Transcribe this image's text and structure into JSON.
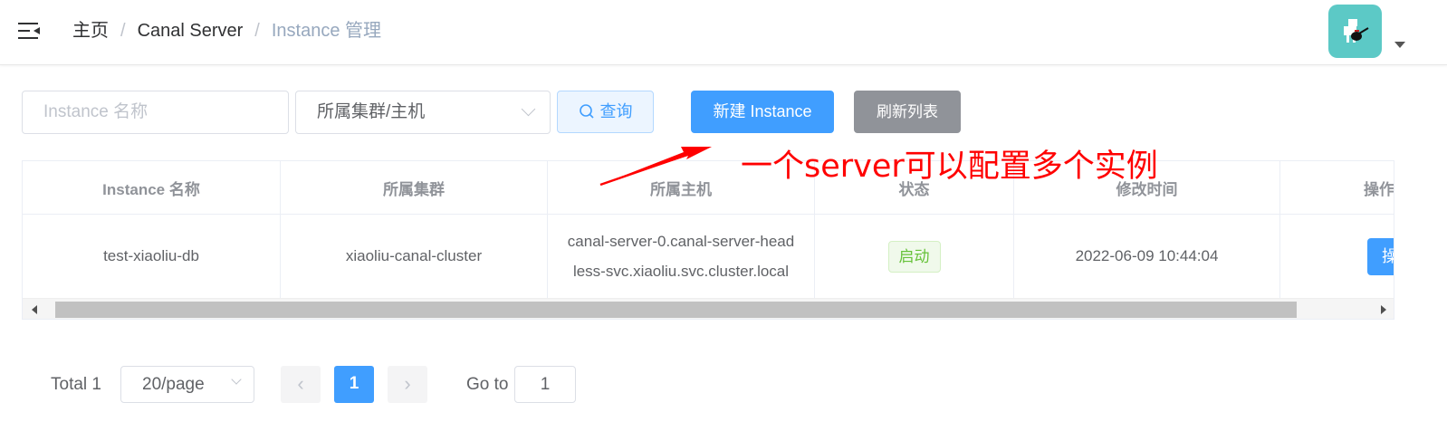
{
  "header": {
    "breadcrumb": [
      "主页",
      "Canal Server",
      "Instance 管理"
    ],
    "breadcrumb_separator": "/"
  },
  "filters": {
    "name_placeholder": "Instance 名称",
    "cluster_select_value": "所属集群/主机",
    "search_label": "查询",
    "create_label": "新建 Instance",
    "refresh_label": "刷新列表"
  },
  "table": {
    "columns": [
      "Instance 名称",
      "所属集群",
      "所属主机",
      "状态",
      "修改时间",
      "操作"
    ],
    "rows": [
      {
        "name": "test-xiaoliu-db",
        "cluster": "xiaoliu-canal-cluster",
        "host_line1": "canal-server-0.canal-server-head",
        "host_line2": "less-svc.xiaoliu.svc.cluster.local",
        "status": "启动",
        "modified": "2022-06-09 10:44:04",
        "action": "操作"
      }
    ]
  },
  "annotation": {
    "text": "一个server可以配置多个实例",
    "color": "#ff0000"
  },
  "pagination": {
    "total_label": "Total 1",
    "page_size": "20/page",
    "current_page": "1",
    "goto_label": "Go to",
    "goto_value": "1"
  },
  "colors": {
    "primary": "#409eff",
    "success": "#67c23a",
    "info": "#909399",
    "avatar_bg": "#5cc9c6"
  }
}
